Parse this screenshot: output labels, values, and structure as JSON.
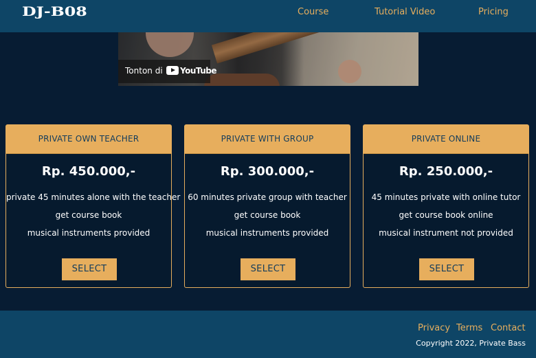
{
  "header": {
    "logo_text": "DJ-B08",
    "nav": [
      {
        "label": "Course"
      },
      {
        "label": "Tutorial Video"
      },
      {
        "label": "Pricing"
      }
    ]
  },
  "video": {
    "watch_on": "Tonton di",
    "platform": "YouTube",
    "icon": "youtube-play-icon"
  },
  "pricing": [
    {
      "title": "PRIVATE OWN TEACHER",
      "price": "Rp. 450.000,-",
      "features": [
        "private 45 minutes alone with the teacher",
        "get course book",
        "musical instruments provided"
      ],
      "button_label": "SELECT"
    },
    {
      "title": "PRIVATE WITH GROUP",
      "price": "Rp. 300.000,-",
      "features": [
        "60 minutes private group with teacher",
        "get course book",
        "musical instruments provided"
      ],
      "button_label": "SELECT"
    },
    {
      "title": "PRIVATE ONLINE",
      "price": "Rp. 250.000,-",
      "features": [
        "45 minutes private with online tutor",
        "get course book online",
        "musical instrument not provided"
      ],
      "button_label": "SELECT"
    }
  ],
  "footer": {
    "links": [
      {
        "label": "Privacy"
      },
      {
        "label": "Terms"
      },
      {
        "label": "Contact"
      }
    ],
    "copyright": "Copyright 2022, Private Bass"
  },
  "colors": {
    "background": "#071c33",
    "nav_background": "#0e4566",
    "accent": "#e7ae5d",
    "header_text": "#123c5c",
    "text": "#ffffff"
  }
}
